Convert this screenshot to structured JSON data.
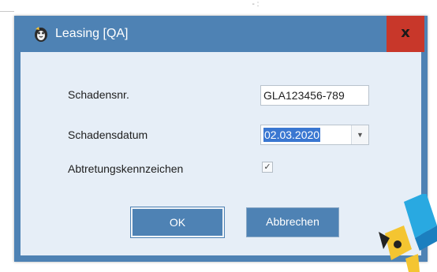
{
  "window": {
    "title": "Leasing [QA]",
    "close_label": "x"
  },
  "form": {
    "claim_number": {
      "label": "Schadensnr.",
      "value": "GLA123456-789"
    },
    "claim_date": {
      "label": "Schadensdatum",
      "value": "02.03.2020"
    },
    "assignment_flag": {
      "label": "Abtretungskennzeichen",
      "checked": true,
      "check_glyph": "✓"
    }
  },
  "buttons": {
    "ok_label": "OK",
    "cancel_label": "Abbrechen"
  },
  "icons": {
    "title_icon": "mascot-icon",
    "dropdown_icon": "chevron-down-icon",
    "corner_logo": "brand-logo-icon"
  },
  "colors": {
    "accent": "#4e82b4",
    "client_bg": "#e6eef7",
    "close_red": "#c8372a",
    "selection": "#3a77d1"
  }
}
